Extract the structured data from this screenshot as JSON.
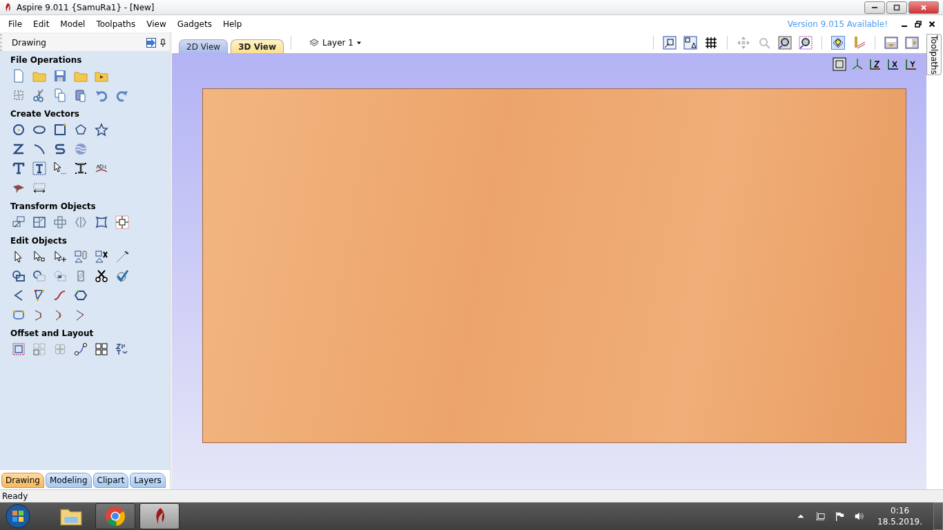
{
  "window": {
    "title": "Aspire 9.011 {SamuRa1} - [New]"
  },
  "menu": [
    "File",
    "Edit",
    "Model",
    "Toolpaths",
    "View",
    "Gadgets",
    "Help"
  ],
  "update_notice": "Version 9.015 Available!",
  "panel": {
    "title": "Drawing",
    "sections": [
      {
        "title": "File Operations"
      },
      {
        "title": "Create Vectors"
      },
      {
        "title": "Transform Objects"
      },
      {
        "title": "Edit Objects"
      },
      {
        "title": "Offset and Layout"
      }
    ]
  },
  "panel_tabs": [
    {
      "label": "Drawing",
      "selected": true
    },
    {
      "label": "Modeling",
      "selected": false
    },
    {
      "label": "Clipart",
      "selected": false
    },
    {
      "label": "Layers",
      "selected": false
    }
  ],
  "view_tabs": [
    {
      "label": "2D View",
      "selected": false
    },
    {
      "label": "3D View",
      "selected": true
    }
  ],
  "layer": {
    "label": "Layer 1"
  },
  "side_tab": "Toolpaths",
  "status_bar": "Ready",
  "taskbar": {
    "time": "0:16",
    "date": "18.5.2019."
  }
}
